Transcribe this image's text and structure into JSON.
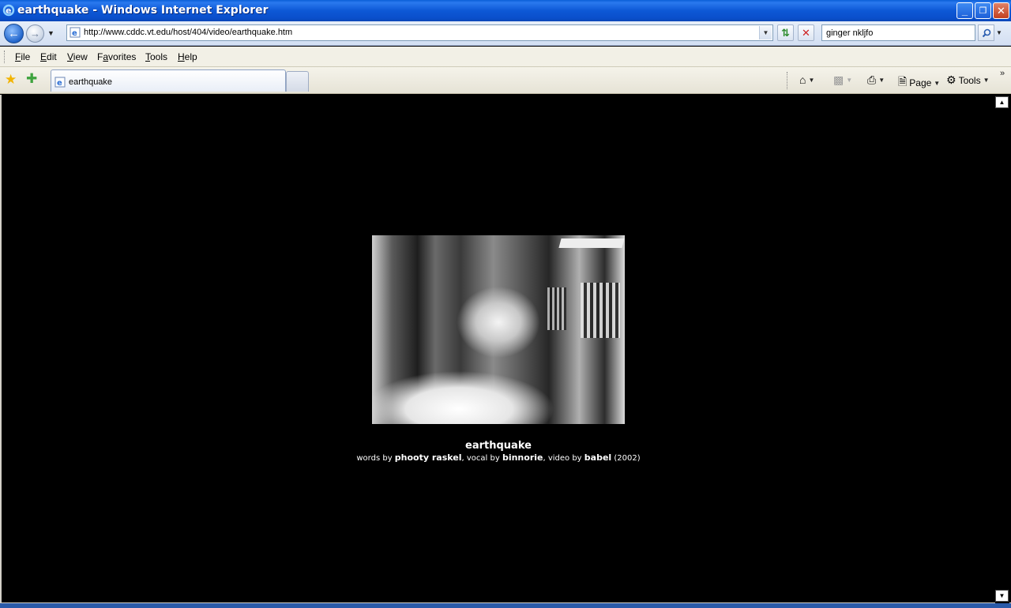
{
  "window": {
    "title": "earthquake - Windows Internet Explorer",
    "buttons": {
      "minimize": "_",
      "restore": "❐",
      "close": "✕"
    }
  },
  "address_bar": {
    "url": "http://www.cddc.vt.edu/host/404/video/earthquake.htm",
    "search_value": "ginger nkljfo"
  },
  "menu": {
    "items": [
      {
        "key": "F",
        "rest": "ile"
      },
      {
        "key": "E",
        "rest": "dit"
      },
      {
        "key": "V",
        "rest": "iew"
      },
      {
        "key": "",
        "pre": "F",
        "mid": "a",
        "rest": "vorites"
      },
      {
        "key": "T",
        "rest": "ools"
      },
      {
        "key": "H",
        "rest": "elp"
      }
    ]
  },
  "tabs": {
    "active_label": "earthquake"
  },
  "command_bar": {
    "page_label": "Page",
    "tools_label": "Tools"
  },
  "page": {
    "title": "earthquake",
    "credits": {
      "words_prefix": "words by ",
      "words_author": "phooty raskel",
      "vocal_prefix": ", vocal by ",
      "vocal_author": "binnorie",
      "video_prefix": ", video by ",
      "video_author": "babel",
      "year": " (2002)"
    }
  },
  "icons": {
    "app": "ie-icon",
    "back": "back-arrow-icon",
    "forward": "forward-arrow-icon",
    "refresh": "refresh-icon",
    "stop": "stop-icon",
    "search": "search-icon",
    "favorites": "favorites-star-icon",
    "add_favorites": "add-favorites-icon",
    "home": "home-icon",
    "feeds": "feeds-icon",
    "print": "print-icon",
    "page": "page-icon",
    "tools": "gear-icon"
  },
  "colors": {
    "titlebar": "#0a5fd8",
    "page_background": "#000000",
    "caption_text": "#ffffff"
  }
}
